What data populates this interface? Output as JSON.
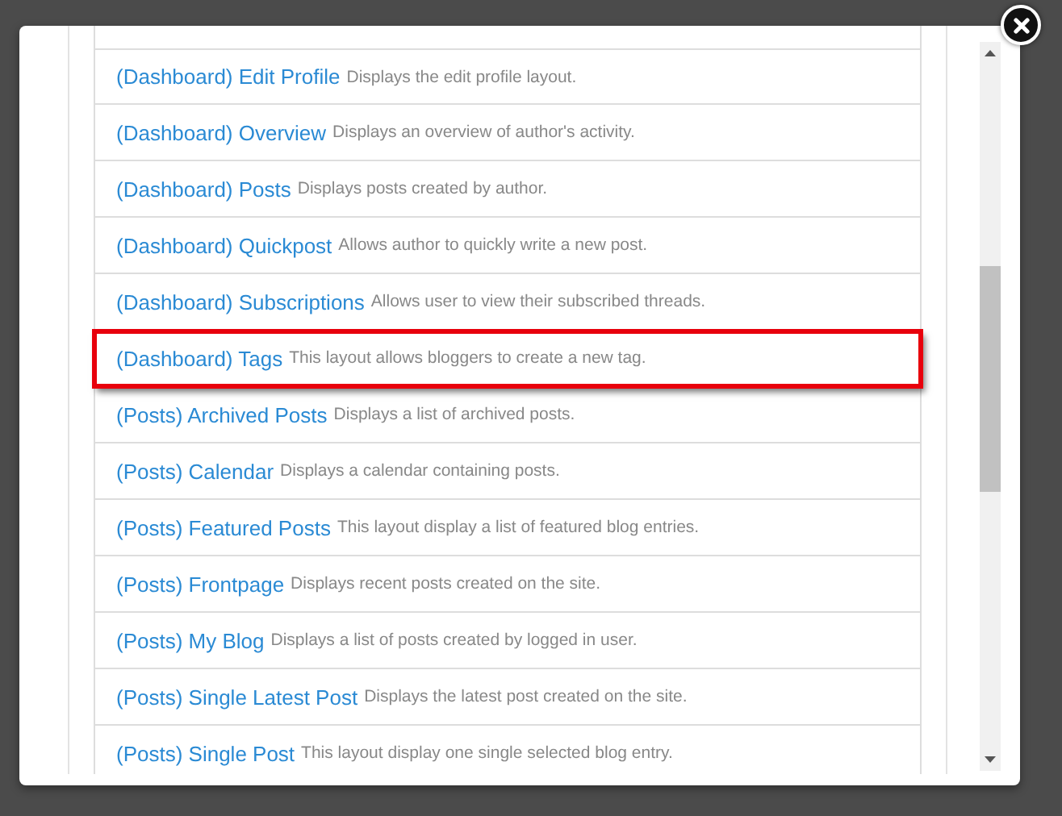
{
  "rows": [
    {
      "title": "(Dashboard) Edit Profile",
      "description": "Displays the edit profile layout.",
      "selected": false
    },
    {
      "title": "(Dashboard) Overview",
      "description": "Displays an overview of author's activity.",
      "selected": false
    },
    {
      "title": "(Dashboard) Posts",
      "description": "Displays posts created by author.",
      "selected": false
    },
    {
      "title": "(Dashboard) Quickpost",
      "description": "Allows author to quickly write a new post.",
      "selected": false
    },
    {
      "title": "(Dashboard) Subscriptions",
      "description": "Allows user to view their subscribed threads.",
      "selected": false
    },
    {
      "title": "(Dashboard) Tags",
      "description": "This layout allows bloggers to create a new tag.",
      "selected": true
    },
    {
      "title": "(Posts) Archived Posts",
      "description": "Displays a list of archived posts.",
      "selected": false
    },
    {
      "title": "(Posts) Calendar",
      "description": "Displays a calendar containing posts.",
      "selected": false
    },
    {
      "title": "(Posts) Featured Posts",
      "description": "This layout display a list of featured blog entries.",
      "selected": false
    },
    {
      "title": "(Posts) Frontpage",
      "description": "Displays recent posts created on the site.",
      "selected": false
    },
    {
      "title": "(Posts) My Blog",
      "description": "Displays a list of posts created by logged in user.",
      "selected": false
    },
    {
      "title": "(Posts) Single Latest Post",
      "description": "Displays the latest post created on the site.",
      "selected": false
    },
    {
      "title": "(Posts) Single Post",
      "description": "This layout display one single selected blog entry.",
      "selected": false
    }
  ]
}
